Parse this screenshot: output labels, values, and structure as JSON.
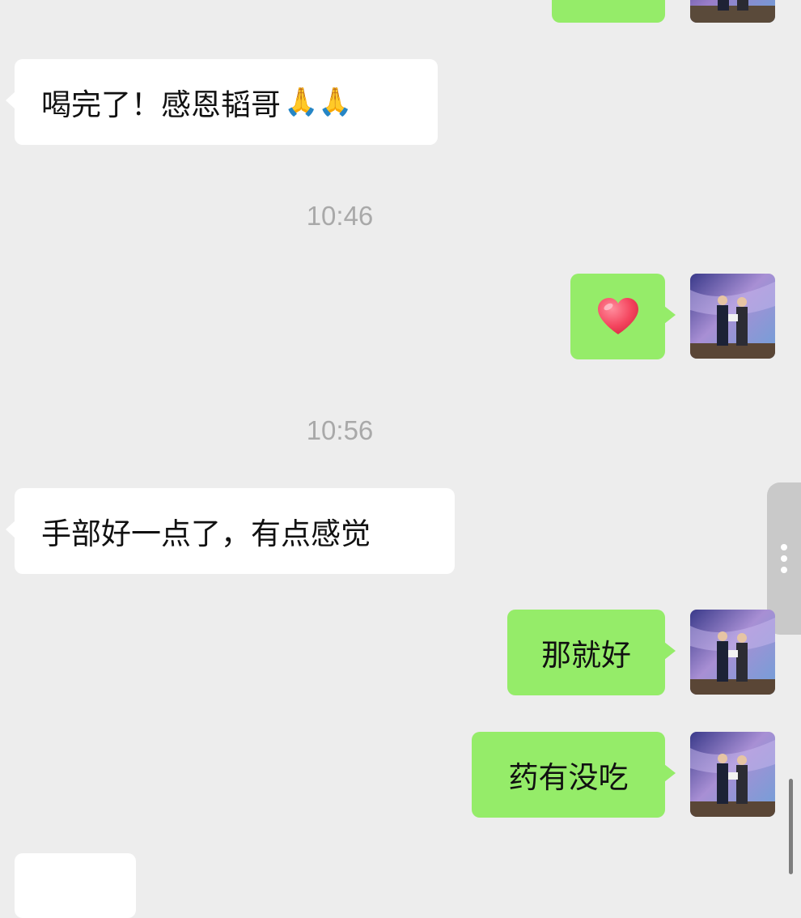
{
  "messages": {
    "m1": {
      "text": "喝完了！感恩韬哥",
      "emoji": "🙏🙏",
      "sender": "contact"
    },
    "m2": {
      "icon": "heart-icon",
      "sender": "me"
    },
    "m3": {
      "text": "手部好一点了，有点感觉",
      "sender": "contact"
    },
    "m4": {
      "text": "那就好",
      "sender": "me"
    },
    "m5": {
      "text": "药有没吃",
      "sender": "me"
    }
  },
  "timestamps": {
    "t1": "10:46",
    "t2": "10:56"
  },
  "colors": {
    "background": "#ededed",
    "incoming_bubble": "#ffffff",
    "outgoing_bubble": "#95ec69",
    "timestamp_text": "#a9a9a9"
  }
}
